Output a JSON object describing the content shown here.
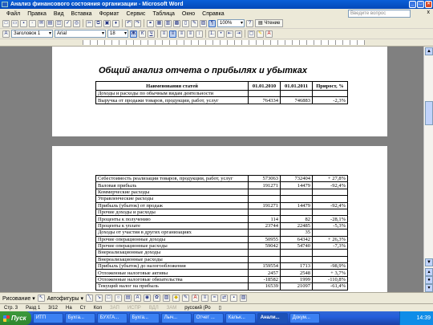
{
  "window": {
    "title": "Анализ финансового состояния организации - Microsoft Word"
  },
  "menu": {
    "items": [
      "Файл",
      "Правка",
      "Вид",
      "Вставка",
      "Формат",
      "Сервис",
      "Таблица",
      "Окно",
      "Справка"
    ],
    "help_placeholder": "Введите вопрос",
    "close_doc": "x"
  },
  "toolbar": {
    "zoom": "100%",
    "reading_label": "Чтение",
    "style": "Заголовок 1",
    "font": "Arial",
    "size": "18",
    "bold": "Ж",
    "italic": "К",
    "underline": "Ч"
  },
  "document": {
    "heading": "Общий анализ отчета о прибылях и убытках",
    "table_header": [
      "Наименования статей",
      "01.01.2010",
      "01.01.2011",
      "Прирост, %"
    ],
    "page1_rows": [
      [
        "Доходы и расходы по обычным видам деятельности",
        "",
        "",
        ""
      ],
      [
        "Выручка от продажи товаров, продукции, работ, услуг",
        "764334",
        "746883",
        "-2,3%"
      ]
    ],
    "page2_rows": [
      [
        "Себестоимость реализации товаров, продукции, работ, услуг",
        "573063",
        "732404",
        "+ 27,8%"
      ],
      [
        "Валовая прибыль",
        "191271",
        "14479",
        "-92,4%"
      ],
      [
        "Коммерческие расходы",
        "",
        "",
        ""
      ],
      [
        "Управленческие расходы",
        "",
        "",
        ""
      ],
      [
        "Прибыль (убыток) от продаж",
        "191271",
        "14479",
        "-92,4%"
      ],
      [
        "Прочие доходы и расходы",
        "",
        "",
        ""
      ],
      [
        "Проценты к получению",
        "114",
        "82",
        "-28,1%"
      ],
      [
        "Проценты к уплате",
        "23744",
        "22485",
        "-5,3%"
      ],
      [
        "Доходы от участия в других организациях",
        "",
        "35",
        ""
      ],
      [
        "Прочие операционные доходы",
        "50955",
        "64342",
        "+ 26,3%"
      ],
      [
        "Прочие операционные расходы",
        "59042",
        "54740",
        "-7,3%"
      ],
      [
        "Внереализационные доходы",
        "",
        "",
        ""
      ],
      [
        "Внереализационные расходы",
        "",
        "",
        ""
      ],
      [
        "Прибыль (убыток) до налогообложения",
        "159554",
        "1713",
        "-98,9%"
      ],
      [
        "Отложенные налоговые активы",
        "2457",
        "2548",
        "+ 3,7%"
      ],
      [
        "Отложенные налоговые обязательства",
        "-18582",
        "1999",
        "-110,8%"
      ],
      [
        "Текущий налог на прибыль",
        "16539",
        "21097",
        "-61,4%"
      ]
    ]
  },
  "drawing": {
    "draw_label": "Рисование",
    "autoshapes_label": "Автофигуры"
  },
  "status": {
    "page": "Стр. 3",
    "section": "Разд 1",
    "pages": "3/12",
    "at": "На",
    "line": "Ст",
    "col": "Кол",
    "rec": "ЗАП",
    "trk": "ИСПР",
    "ext": "ВДЛ",
    "ovr": "ЗАМ",
    "lang": "русский (Ро"
  },
  "taskbar": {
    "start": "Пуск",
    "tasks": [
      "ИТП",
      "Бухга...",
      "БУХГА...",
      "Бухга...",
      "Лыч...",
      "Отчет ...",
      "Кальк...",
      "Анали...",
      "Докум..."
    ],
    "active_index": 7,
    "clock": "14:39"
  }
}
